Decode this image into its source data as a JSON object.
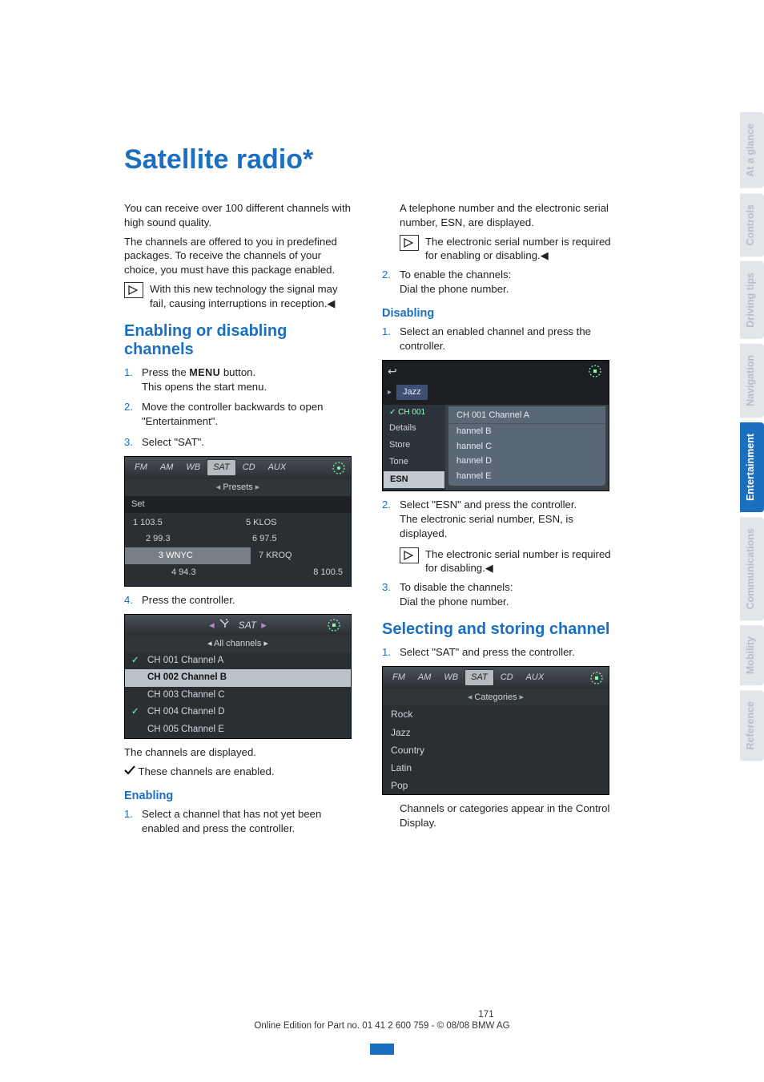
{
  "title": "Satellite radio*",
  "intro1": "You can receive over 100 different channels with high sound quality.",
  "intro2": "The channels are offered to you in predefined packages. To receive the channels of your choice, you must have this package enabled.",
  "note1": "With this new technology the signal may fail, causing interruptions in reception.",
  "h2a": "Enabling or disabling channels",
  "step1a": "Press the ",
  "step1b": " button.",
  "step1c": "This opens the start menu.",
  "menu_word": "MENU",
  "step2": "Move the controller backwards to open \"Entertainment\".",
  "step3": "Select \"SAT\".",
  "fig1": {
    "tabs": [
      "FM",
      "AM",
      "WB",
      "SAT",
      "CD",
      "AUX"
    ],
    "sub": "Presets",
    "set": "Set",
    "rows": [
      [
        "1 103.5",
        "5 KLOS"
      ],
      [
        "2 99.3",
        "6 97.5"
      ],
      [
        "3 WNYC",
        "7 KROQ"
      ],
      [
        "4 94.3",
        "8 100.5"
      ]
    ]
  },
  "step4": "Press the controller.",
  "fig2": {
    "head": "SAT",
    "sub": "All channels",
    "rows": [
      {
        "chk": true,
        "t": "CH 001 Channel A"
      },
      {
        "chk": false,
        "t": "CH 002 Channel B",
        "hl": true
      },
      {
        "chk": false,
        "t": "CH 003 Channel C"
      },
      {
        "chk": true,
        "t": "CH 004 Channel D"
      },
      {
        "chk": false,
        "t": "CH 005 Channel E"
      }
    ]
  },
  "displayed": "The channels are displayed.",
  "enabled_legend": "These channels are enabled.",
  "h3_enabling": "Enabling",
  "en_step1": "Select a channel that has not yet been enabled and press the controller.",
  "col2_p1": "A telephone number and the electronic serial number, ESN, are displayed.",
  "note2": "The electronic serial number is required for enabling or disabling.",
  "en_step2a": "To enable the channels:",
  "en_step2b": "Dial the phone number.",
  "h3_disabling": "Disabling",
  "dis_step1": "Select an enabled channel and press the controller.",
  "fig3": {
    "cat": "Jazz",
    "chlabel": "CH 001 Channel A",
    "left": [
      "Details",
      "Store",
      "Tone",
      "ESN"
    ],
    "right": [
      "hannel B",
      "hannel C",
      "hannel D",
      "hannel E"
    ]
  },
  "dis_step2a": "Select \"ESN\" and press the controller.",
  "dis_step2b": "The electronic serial number, ESN, is displayed.",
  "note3": "The electronic serial number is required for disabling.",
  "dis_step3a": "To disable the channels:",
  "dis_step3b": "Dial the phone number.",
  "h2b": "Selecting and storing channel",
  "sel_step1": "Select \"SAT\" and press the controller.",
  "fig4": {
    "tabs": [
      "FM",
      "AM",
      "WB",
      "SAT",
      "CD",
      "AUX"
    ],
    "sub": "Categories",
    "cats": [
      "Rock",
      "Jazz",
      "Country",
      "Latin",
      "Pop"
    ]
  },
  "sel_p": "Channels or categories appear in the Control Display.",
  "page_num": "171",
  "footer": "Online Edition for Part no. 01 41 2 600 759 - © 08/08 BMW AG",
  "side_tabs": [
    "At a glance",
    "Controls",
    "Driving tips",
    "Navigation",
    "Entertainment",
    "Communications",
    "Mobility",
    "Reference"
  ],
  "nums": {
    "n1": "1.",
    "n2": "2.",
    "n3": "3.",
    "n4": "4."
  }
}
